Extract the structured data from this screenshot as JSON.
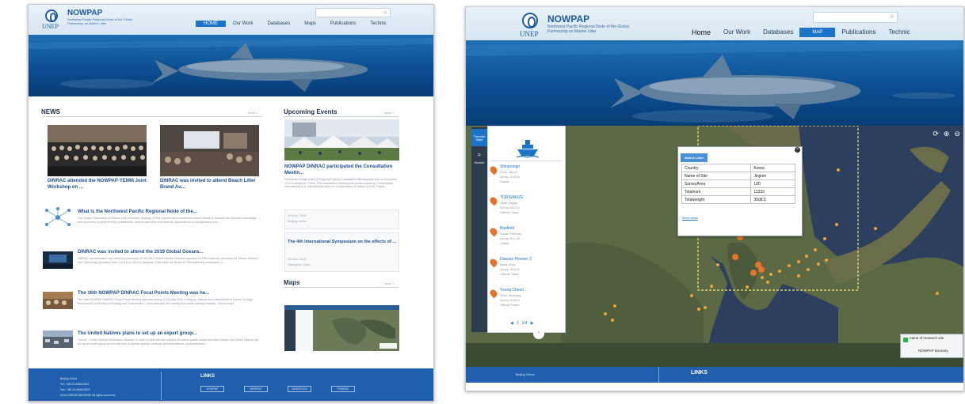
{
  "colors": {
    "brand_blue": "#1f5aa6",
    "nav_active": "#1c74c9",
    "footer_blue": "#1f5fae",
    "ocean": "#0b4e91",
    "marker_orange": "#e8742a"
  },
  "left": {
    "header": {
      "unep": "UNEP",
      "brand": "NOWPAP",
      "tagline": "Northwest Pacific Regional Node of the Global Partnership on Marine Litter",
      "nav": [
        "HOME",
        "Our Work",
        "Databases",
        "Maps",
        "Publications",
        "Technic"
      ]
    },
    "news": {
      "title": "NEWS",
      "more": "more >",
      "cards": [
        {
          "caption": "DINRAC attended the NOWPAP-YEMM Joint Workshop on ..."
        },
        {
          "caption": "DINRAC was invited to attend Beach Litter Brand Au..."
        }
      ],
      "items": [
        {
          "title": "What is the Northwest Pacific Regional Node of the...",
          "body": "The Global Partnership on Marine Litter Honolulu Strategy (GPML) serves as a coordination forum aiming to harness the collective knowledge and resources of governments, practitioners, sectors and other international organizations to strengthening and ..."
        },
        {
          "title": "DINRAC was invited to attend the 2019 Global Oceans...",
          "body": "DINRAC representative was invited to participate in the 2019 Global Oceans Summit organized by Pilot National Laboratory for Marine Science and Technology (Qingdao) from Oct 8 to 9, 2019 in Qingdao, China.With the theme of \"Strengthening cooperation in ..."
        },
        {
          "title": "The 16th NOWPAP DINRAC Focal Points Meeting was he...",
          "body": "The 16th NOWPAP DINRAC Focal Points Meeting was held during 20-21 May 2019 in Beijing. Officials from department of Marine Ecology Environment of Ministry of Ecology and Environment, China attended the meeting and made opening remarks , which emph..."
        },
        {
          "title": "The United Nations plans to set up an expert group...",
          "body": "Source : China Oceanic Information Network: In order to deal with the pollution of marine plastic waste and micro plastic, the United Nations will set up an expert group for the first time to discuss specific methods and international countermeasure..."
        }
      ]
    },
    "events": {
      "title": "Upcoming Events",
      "more": "more >",
      "items": [
        {
          "title": "NOWPAP DINRAC participated the Consultation Meetin...",
          "body": "Freshwater Health Index (Dongping Project) Consultation Meeting was held on November 19 in Guangzhou, China. The consultation meeting was jointly hosted by Conservation International (CI), International Union for Conservation of Nature (IUCN), Peara...",
          "date": "19 Nov, 2018",
          "place": "Beijing China"
        },
        {
          "title": "The 4th International Symposium on the effects of ...",
          "date": "26 Nov, 2018",
          "place": "Shanghai China"
        }
      ]
    },
    "maps": {
      "title": "Maps",
      "more": "more >"
    },
    "footer": {
      "lines": [
        "Beijing China",
        "Tel: +86-10-8466-5303",
        "Fax: +86-10-8466-5303",
        "2018 DINRAC/NOWPAP All rights reserved"
      ],
      "links_title": "LINKS",
      "links": [
        "NOWPAP",
        "MERRAC",
        "NEARGOOS",
        "POMRAC"
      ]
    }
  },
  "right": {
    "header": {
      "unep": "UNEP",
      "brand": "NOWPAP",
      "tagline": "Northwest Pacific Regional Node of the Global Partnership on Marine Litter",
      "nav": [
        "Home",
        "Our Work",
        "Databases",
        "MAP",
        "Publications",
        "Technic"
      ]
    },
    "toolbar": {
      "tool1": "Thematic Maps",
      "tool2": "Search"
    },
    "sites": [
      {
        "name": "Shinjeongri",
        "meta1": "Korea, Jeju-do",
        "meta2": "Survey: 2019.09",
        "meta3": "Coastal"
      },
      {
        "name": "TORISAKIZE",
        "meta1": "Japan, Niigata",
        "meta2": "Survey: 2017.10",
        "meta3": "Offshore Trawls"
      },
      {
        "name": "Banfield",
        "meta1": "Russia, Primorsky",
        "meta2": "Survey: 2017.08",
        "meta3": "Coastal"
      },
      {
        "name": "Daesan Pioneer 2",
        "meta1": "Korea, Ulsan",
        "meta2": "Survey: 2019.06",
        "meta3": "Offshore Trawls"
      },
      {
        "name": "Young Cheon",
        "meta1": "China, Shandong",
        "meta2": "Survey: 2018.03",
        "meta3": "Offshore Trawls"
      }
    ],
    "pager": [
      "◀",
      "1",
      "1/4",
      "▶"
    ],
    "popup": {
      "tab": "Marine Litter",
      "rows": [
        {
          "label": "Country",
          "value": "Korea"
        },
        {
          "label": "Name of Site",
          "value": "Jinjeon"
        },
        {
          "label": "SurveyArea",
          "value": "100"
        },
        {
          "label": "Totalnum",
          "value": "11333"
        },
        {
          "label": "Totalweight",
          "value": "3508.5"
        }
      ],
      "more": "more detail"
    },
    "legend": {
      "item1": "name of research site",
      "item2": "NOWPAP Bounary"
    },
    "footer": {
      "left": "Beijing China",
      "links": "LINKS"
    }
  }
}
